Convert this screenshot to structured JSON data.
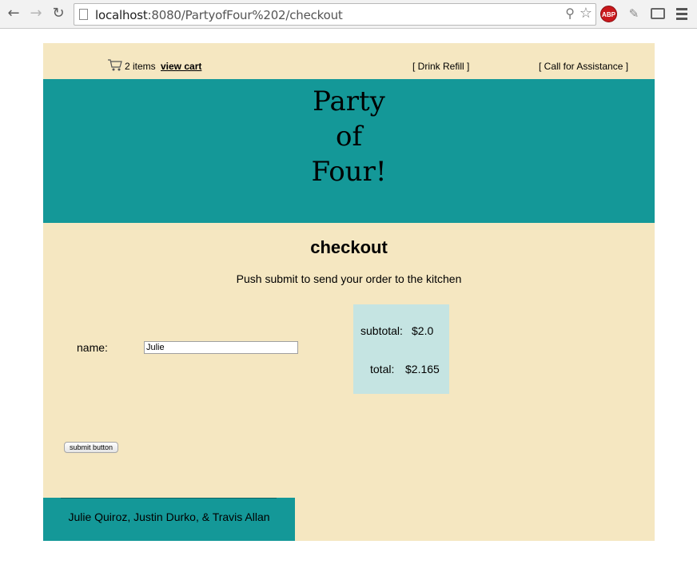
{
  "browser": {
    "url_host": "localhost",
    "url_path": ":8080/PartyofFour%202/checkout",
    "extension_label": "ABP"
  },
  "topbar": {
    "cart_count_text": "2 items",
    "view_cart_label": "view cart",
    "drink_refill_label": "[ Drink Refill ]",
    "assistance_label": "[ Call for Assistance ]"
  },
  "banner": {
    "title": "Party\nof\nFour!"
  },
  "checkout": {
    "heading": "checkout",
    "instruction": "Push submit to send your order to the kitchen",
    "name_label": "name:",
    "name_value": "Julie",
    "subtotal_label": "subtotal:",
    "subtotal_value": "$2.0",
    "total_label": "total:",
    "total_value": "$2.165",
    "submit_label": "submit button"
  },
  "footer": {
    "credits": "Julie Quiroz, Justin Durko, & Travis Allan"
  },
  "colors": {
    "page_bg": "#f5e7c1",
    "teal": "#149898",
    "totals_bg": "#c5e4e2"
  }
}
